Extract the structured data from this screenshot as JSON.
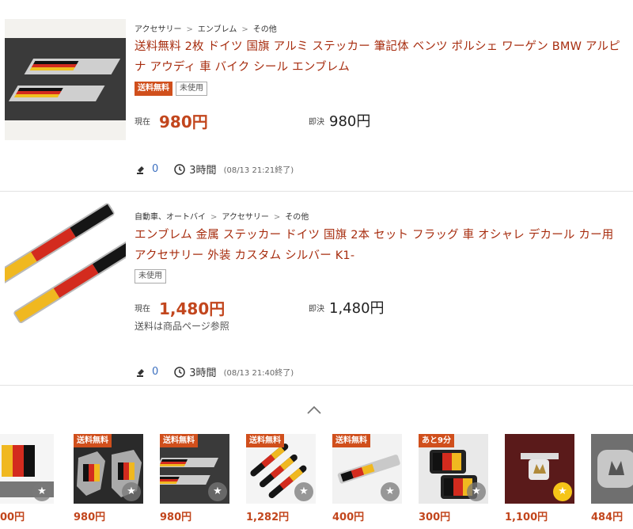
{
  "items": [
    {
      "breadcrumb": [
        "アクセサリー",
        "エンブレム",
        "その他"
      ],
      "title_line1": "送料無料 2枚 ドイツ 国旗 アルミ ステッカー 筆記体 ベンツ ポルシェ ワーゲン BMW アルピ",
      "title_line2": "ナ アウディ 車 バイク シール エンブレム",
      "tag_free": "送料無料",
      "tag_condition": "未使用",
      "current_label": "現在",
      "current_price": "980円",
      "buyout_label": "即決",
      "buyout_price": "980円",
      "bids": "0",
      "time_left": "3時間",
      "end_time": "(08/13 21:21終了)"
    },
    {
      "breadcrumb": [
        "自動車、オートバイ",
        "アクセサリー",
        "その他"
      ],
      "title_line1": "エンブレム 金属 ステッカー ドイツ 国旗 2本 セット フラッグ 車 オシャレ デカール カー用",
      "title_line2": "アクセサリー 外装 カスタム シルバー K1-",
      "tag_condition": "未使用",
      "current_label": "現在",
      "current_price": "1,480円",
      "buyout_label": "即決",
      "buyout_price": "1,480円",
      "shipping_note": "送料は商品ページ参照",
      "bids": "0",
      "time_left": "3時間",
      "end_time": "(08/13 21:40終了)"
    }
  ],
  "carousel": [
    {
      "price": "00円",
      "badge": "",
      "fav_icon": "star-icon",
      "fav_on": false
    },
    {
      "price": "980円",
      "badge": "送料無料",
      "fav_icon": "star-icon",
      "fav_on": false
    },
    {
      "price": "980円",
      "badge": "送料無料",
      "fav_icon": "star-icon",
      "fav_on": false
    },
    {
      "price": "1,282円",
      "badge": "送料無料",
      "fav_icon": "star-icon",
      "fav_on": false
    },
    {
      "price": "400円",
      "badge": "送料無料",
      "fav_icon": "star-icon",
      "fav_on": false
    },
    {
      "price": "300円",
      "badge": "あと9分",
      "fav_icon": "star-icon",
      "fav_on": false
    },
    {
      "price": "1,100円",
      "badge": "",
      "fav_icon": "star-icon",
      "fav_on": true
    },
    {
      "price": "484円",
      "badge": "",
      "fav_icon": "star-icon",
      "fav_on": false
    }
  ],
  "colors": {
    "title": "#a72d0f",
    "price": "#c2461d",
    "badge": "#d04f1c",
    "bids": "#3b6fbf",
    "fav_on": "#f5c518"
  }
}
